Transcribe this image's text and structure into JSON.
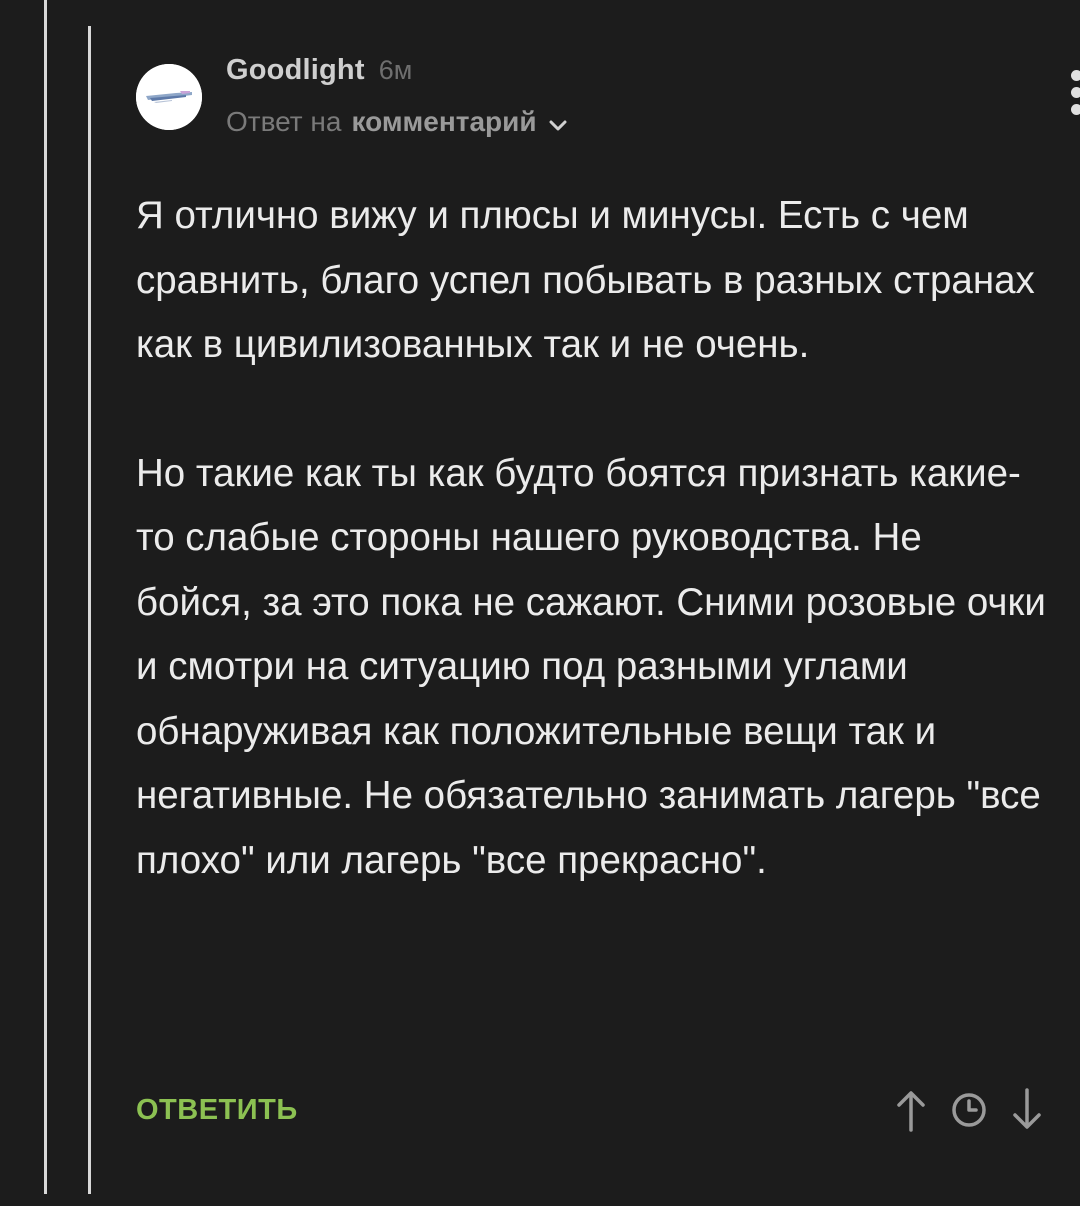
{
  "comment": {
    "username": "Goodlight",
    "timestamp": "6м",
    "reply_prefix": "Ответ на",
    "reply_target": "комментарий",
    "paragraphs": [
      "Я отлично вижу и плюсы и минусы. Есть с чем сравнить, благо успел побывать в разных странах как в цивилизованных так и не очень.",
      "Но такие как ты как будто боятся признать какие-то слабые стороны нашего руководства. Не бойся, за это пока не сажают. Сними розовые очки и смотри на ситуацию под разными углами обнаруживая как положительные вещи так и негативные. Не обязательно занимать лагерь \"все плохо\" или лагерь \"все прекрасно\"."
    ]
  },
  "footer": {
    "reply_button": "ОТВЕТИТЬ"
  },
  "icons": {
    "menu": "more-vertical-icon",
    "chevron": "chevron-down-icon",
    "up": "arrow-up-icon",
    "clock": "clock-icon",
    "down": "arrow-down-icon"
  },
  "colors": {
    "background": "#1c1c1c",
    "accent_green": "#8cc152",
    "text": "#ebebeb",
    "muted": "#7a7a7a"
  }
}
